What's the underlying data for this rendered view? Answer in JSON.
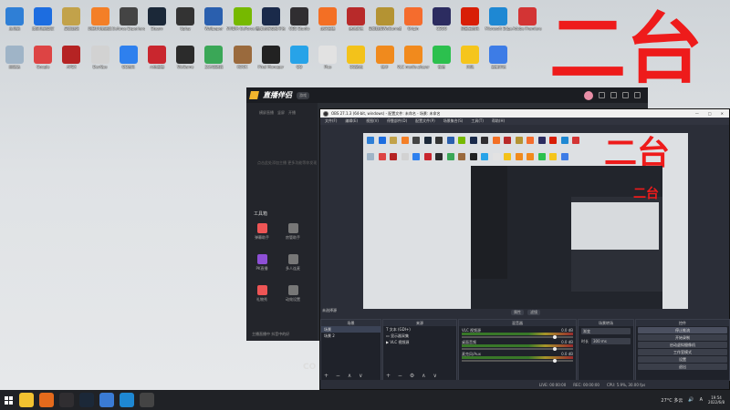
{
  "desktop": {
    "overlay_text_large": "二台",
    "overlay_text_medium": "二台",
    "overlay_text_small": "二台",
    "row1": [
      {
        "label": "此电脑",
        "color": "#2f7fd6"
      },
      {
        "label": "腾讯电脑管家",
        "color": "#1d6de0"
      },
      {
        "label": "英雄联盟",
        "color": "#c2a24a"
      },
      {
        "label": "网易UU加速器",
        "color": "#f47f27"
      },
      {
        "label": "Geforce Experience",
        "color": "#444444"
      },
      {
        "label": "Steam",
        "color": "#1b2838"
      },
      {
        "label": "Uplay",
        "color": "#333333"
      },
      {
        "label": "Wallpaper",
        "color": "#2a5fae"
      },
      {
        "label": "NVIDIA GeForce Experience",
        "color": "#76b900"
      },
      {
        "label": "完美世界竞技平台",
        "color": "#1a2a4a"
      },
      {
        "label": "OBS Studio",
        "color": "#302e31"
      },
      {
        "label": "虎牙直播",
        "color": "#f36f24"
      },
      {
        "label": "绝地求生",
        "color": "#b82a2a"
      },
      {
        "label": "英雄联盟WeGame版",
        "color": "#b49333"
      },
      {
        "label": "Origin",
        "color": "#f56c2d"
      },
      {
        "label": "CSGO",
        "color": "#2c2c60"
      },
      {
        "label": "网易云音乐",
        "color": "#d81e06"
      },
      {
        "label": "Microsoft Edge",
        "color": "#1e88d3"
      },
      {
        "label": "Adobe Premiere",
        "color": "#d33434"
      }
    ],
    "row2": [
      {
        "label": "回收站",
        "color": "#9fb4c7"
      },
      {
        "label": "Google",
        "color": "#d44"
      },
      {
        "label": "APEX",
        "color": "#b52323"
      },
      {
        "label": "DevOps",
        "color": "#d2d2d2"
      },
      {
        "label": "QQ音乐",
        "color": "#2e80ee"
      },
      {
        "label": "斗鱼直播",
        "color": "#c9262e"
      },
      {
        "label": "WeGame",
        "color": "#2b2b2b"
      },
      {
        "label": "文件管理器",
        "color": "#3aa757"
      },
      {
        "label": "KOOK",
        "color": "#9a6a3d"
      },
      {
        "label": "Pixel Manager",
        "color": "#222222"
      },
      {
        "label": "QQ",
        "color": "#27a3e8"
      },
      {
        "label": "Plus",
        "color": "#e2e2e2"
      },
      {
        "label": "QQ游戏",
        "color": "#f3c21a"
      },
      {
        "label": "快手",
        "color": "#f08a1d"
      },
      {
        "label": "VLC media player",
        "color": "#f18a1d"
      },
      {
        "label": "微信",
        "color": "#2cc04e"
      },
      {
        "label": "闪电",
        "color": "#f5c51c"
      },
      {
        "label": "直播伴侣",
        "color": "#3d7ce6"
      }
    ]
  },
  "zhibo": {
    "title": "直播伴侣",
    "badge": "游戏",
    "nav": [
      "横屏直播",
      "竖屏",
      "开播"
    ],
    "hint": "点击此处添加主播 更多功能等你发现",
    "tools_heading": "工具箱",
    "tools": [
      {
        "label": "弹幕助手",
        "color": "#e55"
      },
      {
        "label": "房管助手",
        "color": "#777"
      },
      {
        "label": "PK直播",
        "color": "#8e4fd6"
      },
      {
        "label": "多人连麦",
        "color": "#777"
      },
      {
        "label": "礼物秀",
        "color": "#e55"
      },
      {
        "label": "动效设置",
        "color": "#777"
      }
    ],
    "bottom": "主播直播中 抖音中的好",
    "partial_text": "CO"
  },
  "obs": {
    "title": "OBS 27.1.3 (64-bit, windows) - 配置文件: 未命名 - 场景: 未命名",
    "menu": [
      "文件(F)",
      "编辑(E)",
      "视图(V)",
      "停靠部件(D)",
      "配置文件(P)",
      "场景集合(S)",
      "工具(T)",
      "帮助(H)"
    ],
    "scene_label": "未选择源",
    "toolbar": [
      "属性",
      "滤镜"
    ],
    "scenes_header": "场景",
    "scenes": [
      "场景",
      "场景 2"
    ],
    "sources_header": "来源",
    "sources": [
      "文本 (GDI+)",
      "显示器采集",
      "VLC 视频源"
    ],
    "mixer_header": "混音器",
    "mixer": [
      {
        "name": "VLC 视频源",
        "db": "0.0 dB"
      },
      {
        "name": "桌面音频",
        "db": "0.0 dB"
      },
      {
        "name": "麦克风/Aux",
        "db": "0.0 dB"
      }
    ],
    "transitions_header": "场景转场",
    "transition_type": "渐变",
    "duration_label": "时长",
    "duration_value": "300 ms",
    "controls_header": "控件",
    "controls": [
      "停止推流",
      "开始录制",
      "启动虚拟摄像机",
      "工作室模式",
      "设置",
      "退出"
    ],
    "status": [
      "LIVE: 00:00:00",
      "REC: 00:00:00",
      "CPU: 5.9%, 30.00 fps"
    ]
  },
  "taskbar": {
    "apps": [
      {
        "name": "file-explorer",
        "color": "#f2c230"
      },
      {
        "name": "mail",
        "color": "#e46a1c"
      },
      {
        "name": "obs",
        "color": "#302e31"
      },
      {
        "name": "steam",
        "color": "#1b2838"
      },
      {
        "name": "chrome",
        "color": "#3a7bd5"
      },
      {
        "name": "edge",
        "color": "#1e88d3"
      },
      {
        "name": "terminal",
        "color": "#444444"
      }
    ],
    "weather": "27°C 多云",
    "time": "19:54",
    "date": "2022/6/8",
    "lang": "A"
  }
}
